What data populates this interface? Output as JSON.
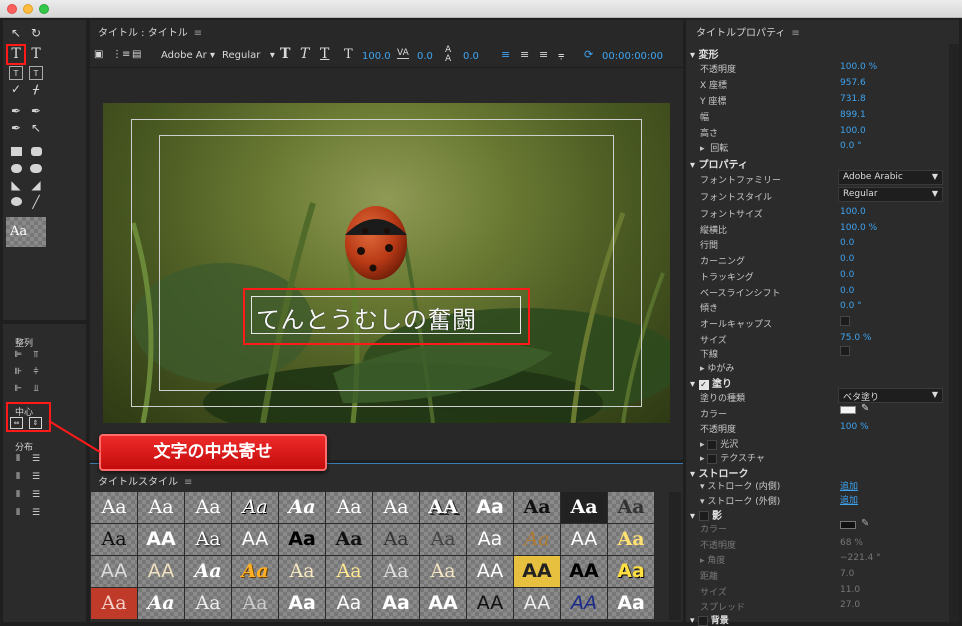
{
  "left_panel": {
    "align_title": "整列",
    "center_title": "中心",
    "distribute_title": "分布",
    "style_preview": "Aa"
  },
  "title_panel": {
    "title": "タイトル : タイトル",
    "font_family": "Adobe Ar",
    "font_style": "Regular",
    "font_size": "100.0",
    "tracking": "0.0",
    "leading": "0.0",
    "timecode": "00:00:00:00",
    "canvas_text": "てんとうむしの奮闘"
  },
  "styles_panel": {
    "title": "タイトルスタイル",
    "swatches": [
      "Aa",
      "Aa",
      "Aa",
      "Aa",
      "Aa",
      "Aa",
      "Aa",
      "AA",
      "Aa",
      "Aa",
      "Aa",
      "Aa",
      "Aa",
      "AA",
      "Aa",
      "AA",
      "Aa",
      "Aa",
      "Aa",
      "Aa",
      "Aa",
      "Aa",
      "AA",
      "Aa",
      "AA",
      "AA",
      "Aa",
      "Aa",
      "Aa",
      "Aa",
      "Aa",
      "Aa",
      "AA",
      "AA",
      "AA",
      "Aa",
      "Aa",
      "Aa",
      "Aa",
      "Aa",
      "Aa",
      "Aa",
      "Aa",
      "AA",
      "AA",
      "AA",
      "AA",
      "Aa"
    ]
  },
  "callout": {
    "text": "文字の中央寄せ"
  },
  "props": {
    "title": "タイトルプロパティ",
    "transform": "変形",
    "opacity_label": "不透明度",
    "opacity": "100.0 %",
    "x_label": "X 座標",
    "x": "957.6",
    "y_label": "Y 座標",
    "y": "731.8",
    "w_label": "幅",
    "w": "899.1",
    "h_label": "高さ",
    "h": "100.0",
    "rot_label": "回転",
    "rot": "0.0 °",
    "properties": "プロパティ",
    "ff_label": "フォントファミリー",
    "ff": "Adobe Arabic",
    "fs_label": "フォントスタイル",
    "fs": "Regular",
    "size_label": "フォントサイズ",
    "size": "100.0",
    "aspect_label": "縦横比",
    "aspect": "100.0 %",
    "leading_label": "行間",
    "leading": "0.0",
    "kern_label": "カーニング",
    "kern": "0.0",
    "track_label": "トラッキング",
    "track": "0.0",
    "base_label": "ベースラインシフト",
    "base": "0.0",
    "slant_label": "傾き",
    "slant": "0.0 °",
    "caps_label": "オールキャップス",
    "capsize_label": "サイズ",
    "capsize": "75.0 %",
    "underline_label": "下線",
    "distort_label": "ゆがみ",
    "fill": "塗り",
    "filltype_label": "塗りの種類",
    "filltype": "ベタ塗り",
    "color_label": "カラー",
    "fillop_label": "不透明度",
    "fillop": "100 %",
    "sheen_label": "光沢",
    "texture_label": "テクスチャ",
    "stroke": "ストローク",
    "inner_label": "ストローク (内側)",
    "inner": "追加",
    "outer_label": "ストローク (外側)",
    "outer": "追加",
    "shadow": "影",
    "sh_color_label": "カラー",
    "sh_op_label": "不透明度",
    "sh_op": "68 %",
    "sh_angle_label": "角度",
    "sh_angle": "−221.4 °",
    "sh_dist_label": "距離",
    "sh_dist": "7.0",
    "sh_size_label": "サイズ",
    "sh_size": "11.0",
    "sh_spread_label": "スプレッド",
    "sh_spread": "27.0",
    "bg": "背景"
  }
}
